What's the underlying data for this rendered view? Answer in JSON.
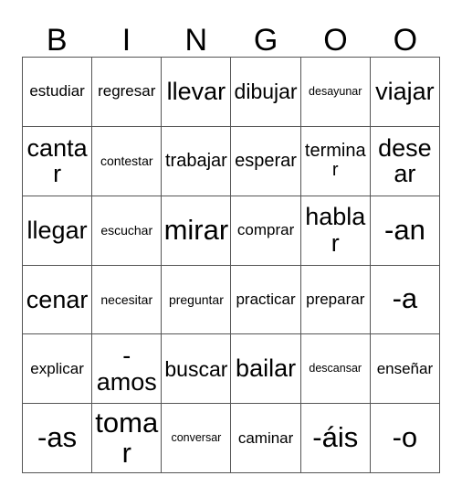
{
  "card": {
    "header_letters": [
      "B",
      "I",
      "N",
      "G",
      "O",
      "O"
    ],
    "rows": [
      [
        {
          "text": "estudiar",
          "size": "fs-sm"
        },
        {
          "text": "regresar",
          "size": "fs-sm"
        },
        {
          "text": "llevar",
          "size": "fs-xl"
        },
        {
          "text": "dibujar",
          "size": "fs-lg"
        },
        {
          "text": "desayunar",
          "size": "fs-xxs"
        },
        {
          "text": "viajar",
          "size": "fs-xl"
        }
      ],
      [
        {
          "text": "cantar",
          "size": "fs-xl"
        },
        {
          "text": "contestar",
          "size": "fs-xs"
        },
        {
          "text": "trabajar",
          "size": "fs-md"
        },
        {
          "text": "esperar",
          "size": "fs-md"
        },
        {
          "text": "terminar",
          "size": "fs-md"
        },
        {
          "text": "desear",
          "size": "fs-xl"
        }
      ],
      [
        {
          "text": "llegar",
          "size": "fs-xl"
        },
        {
          "text": "escuchar",
          "size": "fs-xs"
        },
        {
          "text": "mirar",
          "size": "fs-xxl"
        },
        {
          "text": "comprar",
          "size": "fs-sm"
        },
        {
          "text": "hablar",
          "size": "fs-xl"
        },
        {
          "text": "-an",
          "size": "fs-xxl"
        }
      ],
      [
        {
          "text": "cenar",
          "size": "fs-xl"
        },
        {
          "text": "necesitar",
          "size": "fs-xs"
        },
        {
          "text": "preguntar",
          "size": "fs-xs"
        },
        {
          "text": "practicar",
          "size": "fs-sm"
        },
        {
          "text": "preparar",
          "size": "fs-sm"
        },
        {
          "text": "-a",
          "size": "fs-xxl"
        }
      ],
      [
        {
          "text": "explicar",
          "size": "fs-sm"
        },
        {
          "text": "-amos",
          "size": "fs-xl"
        },
        {
          "text": "buscar",
          "size": "fs-lg"
        },
        {
          "text": "bailar",
          "size": "fs-xl"
        },
        {
          "text": "descansar",
          "size": "fs-xxs"
        },
        {
          "text": "enseñar",
          "size": "fs-sm"
        }
      ],
      [
        {
          "text": "-as",
          "size": "fs-xxl"
        },
        {
          "text": "tomar",
          "size": "fs-xxl"
        },
        {
          "text": "conversar",
          "size": "fs-xxs"
        },
        {
          "text": "caminar",
          "size": "fs-sm"
        },
        {
          "text": "-áis",
          "size": "fs-xxl"
        },
        {
          "text": "-o",
          "size": "fs-xxl"
        }
      ]
    ]
  },
  "colors": {
    "grid_line": "#555555",
    "text": "#000000",
    "background": "#ffffff"
  }
}
